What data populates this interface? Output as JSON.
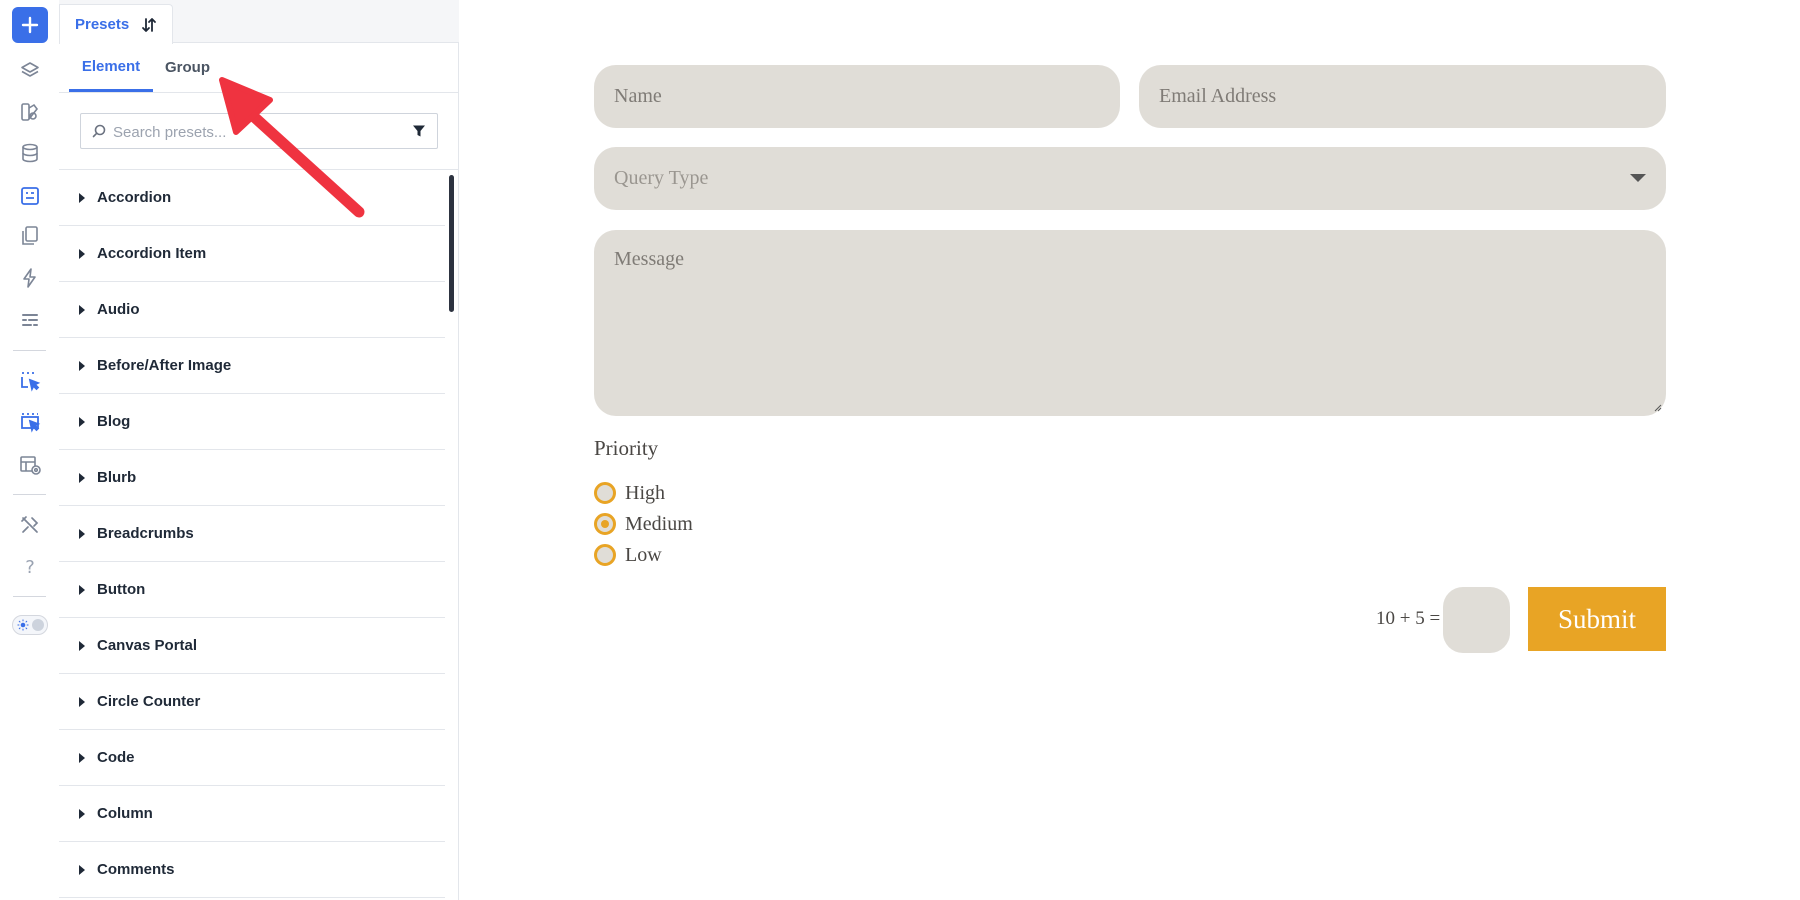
{
  "rail": {
    "icons": [
      "add-icon",
      "layers-icon",
      "shapes-icon",
      "database-icon",
      "form-icon",
      "copy-pages-icon",
      "lightning-icon",
      "sections-icon",
      "cursor-select-icon",
      "cursor-select-alt-icon",
      "layout-preview-icon",
      "tools-icon",
      "help-icon",
      "theme-toggle"
    ],
    "help_label": "?"
  },
  "panel": {
    "tab_label": "Presets",
    "subtabs": [
      {
        "label": "Element",
        "active": true
      },
      {
        "label": "Group",
        "active": false
      }
    ],
    "search_placeholder": "Search presets...",
    "items": [
      "Accordion",
      "Accordion Item",
      "Audio",
      "Before/After Image",
      "Blog",
      "Blurb",
      "Breadcrumbs",
      "Button",
      "Canvas Portal",
      "Circle Counter",
      "Code",
      "Column",
      "Comments"
    ]
  },
  "form": {
    "name_placeholder": "Name",
    "email_placeholder": "Email Address",
    "query_placeholder": "Query Type",
    "message_placeholder": "Message",
    "priority_label": "Priority",
    "priority_options": [
      {
        "label": "High",
        "checked": false
      },
      {
        "label": "Medium",
        "checked": true
      },
      {
        "label": "Low",
        "checked": false
      }
    ],
    "captcha": "10 + 5 =",
    "submit_label": "Submit"
  },
  "colors": {
    "accent": "#3a6fe8",
    "field_bg": "#e0ddd7",
    "submit": "#e8a425",
    "annotation": "#ef3340"
  }
}
